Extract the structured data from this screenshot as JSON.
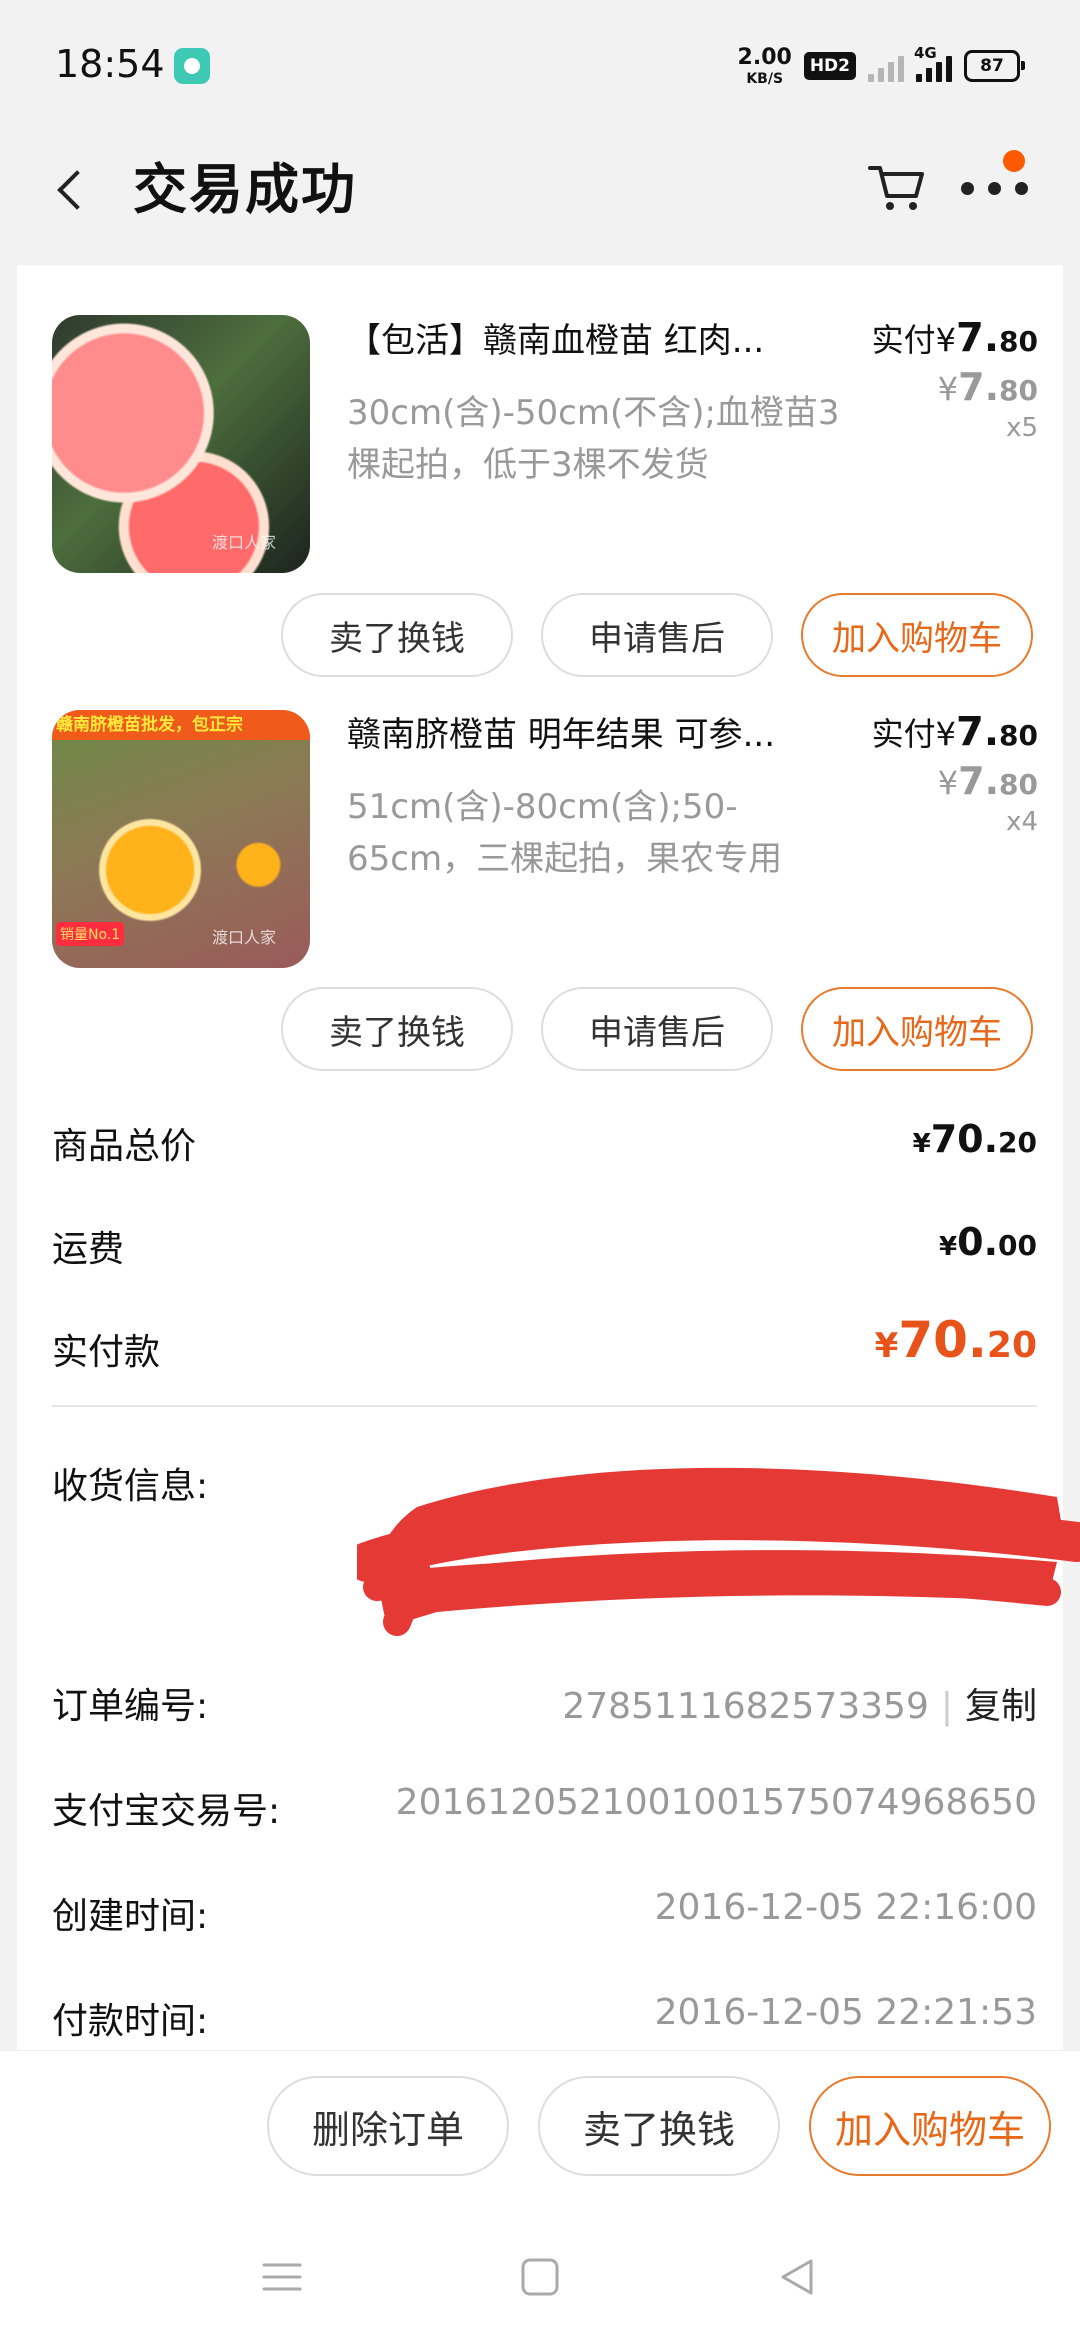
{
  "status_bar": {
    "time": "18:54",
    "net_speed_value": "2.00",
    "net_speed_unit": "KB/S",
    "hd_badge": "HD2",
    "network_type": "4G",
    "battery": "87"
  },
  "header": {
    "title": "交易成功"
  },
  "items": [
    {
      "title": "【包活】赣南血橙苗 红肉...",
      "spec": "30cm(含)-50cm(不含);血橙苗3棵起拍，低于3棵不发货",
      "paid_label": "实付",
      "paid_yen": "¥",
      "paid_int": "7.",
      "paid_dec": "80",
      "orig_yen": "¥",
      "orig_int": "7.",
      "orig_dec": "80",
      "qty": "x5",
      "watermark": "渡口人家",
      "buttons": [
        "卖了换钱",
        "申请售后",
        "加入购物车"
      ]
    },
    {
      "title": "赣南脐橙苗 明年结果 可参...",
      "spec": "51cm(含)-80cm(含);50-65cm，三棵起拍，果农专用",
      "paid_label": "实付",
      "paid_yen": "¥",
      "paid_int": "7.",
      "paid_dec": "80",
      "orig_yen": "¥",
      "orig_int": "7.",
      "orig_dec": "80",
      "qty": "x4",
      "banner": "赣南脐橙苗批发，包正宗",
      "badge": "销量No.1",
      "watermark": "渡口人家",
      "buttons": [
        "卖了换钱",
        "申请售后",
        "加入购物车"
      ]
    }
  ],
  "summary": {
    "goods_total_label": "商品总价",
    "goods_total": {
      "yen": "¥",
      "int": "70.",
      "dec": "20"
    },
    "shipping_label": "运费",
    "shipping": {
      "yen": "¥",
      "int": "0.",
      "dec": "00"
    },
    "paid_label": "实付款",
    "paid": {
      "yen": "¥",
      "int": "70.",
      "dec": "20"
    }
  },
  "info": {
    "receiver_label": "收货信息:",
    "order_no_label": "订单编号:",
    "order_no": "2785111682573359",
    "separator": "|",
    "copy_label": "复制",
    "alipay_label": "支付宝交易号:",
    "alipay_no": "2016120521001001575074968650",
    "created_label": "创建时间:",
    "created_time": "2016-12-05 22:16:00",
    "paid_time_label": "付款时间:",
    "paid_time": "2016-12-05 22:21:53"
  },
  "bottom_actions": {
    "delete": "删除订单",
    "sell": "卖了换钱",
    "add_cart": "加入购物车"
  },
  "colors": {
    "accent": "#e8681a",
    "badge_dot": "#ff5a00",
    "redaction": "#e53935"
  }
}
